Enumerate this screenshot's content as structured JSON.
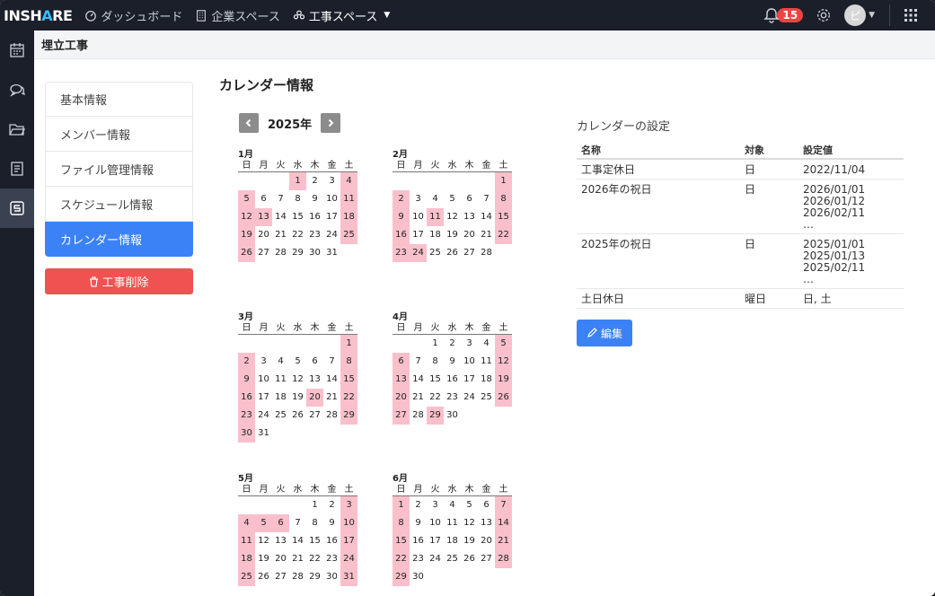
{
  "topbar": {
    "logo": "INSHARE",
    "nav": [
      {
        "label": "ダッシュボード",
        "icon": "dashboard-icon"
      },
      {
        "label": "企業スペース",
        "icon": "building-icon"
      },
      {
        "label": "工事スペース",
        "icon": "people-icon",
        "active": true
      }
    ],
    "notification_count": "15",
    "avatar_initial": "ピ"
  },
  "sidebar": {
    "items": [
      "calendar-icon",
      "chat-icon",
      "folder-icon",
      "document-icon",
      "schedule-icon"
    ],
    "active_index": 4
  },
  "page": {
    "breadcrumb": "埋立工事",
    "section_title": "カレンダー情報"
  },
  "leftnav": {
    "items": [
      "基本情報",
      "メンバー情報",
      "ファイル管理情報",
      "スケジュール情報",
      "カレンダー情報"
    ],
    "active_index": 4,
    "delete_label": "工事削除"
  },
  "calendar": {
    "year_label": "2025年",
    "weekdays": [
      "日",
      "月",
      "火",
      "水",
      "木",
      "金",
      "土"
    ],
    "holiday_color": "#f9c0cb",
    "months": [
      {
        "title": "1月",
        "offset": 3,
        "days": 31,
        "holidays": [
          1,
          4,
          5,
          11,
          12,
          13,
          18,
          19,
          25,
          26
        ]
      },
      {
        "title": "2月",
        "offset": 6,
        "days": 28,
        "holidays": [
          1,
          2,
          8,
          9,
          11,
          15,
          16,
          22,
          23,
          24
        ]
      },
      {
        "title": "3月",
        "offset": 6,
        "days": 31,
        "holidays": [
          1,
          2,
          8,
          9,
          15,
          16,
          20,
          22,
          23,
          29,
          30
        ]
      },
      {
        "title": "4月",
        "offset": 2,
        "days": 30,
        "holidays": [
          5,
          6,
          12,
          13,
          19,
          20,
          26,
          27,
          29
        ]
      },
      {
        "title": "5月",
        "offset": 4,
        "days": 31,
        "holidays": [
          3,
          4,
          5,
          6,
          10,
          11,
          17,
          18,
          24,
          25,
          31
        ]
      },
      {
        "title": "6月",
        "offset": 0,
        "days": 30,
        "holidays": [
          1,
          7,
          8,
          14,
          15,
          21,
          22,
          28,
          29
        ]
      }
    ]
  },
  "settings": {
    "title": "カレンダーの設定",
    "headers": [
      "名称",
      "対象",
      "設定値"
    ],
    "rows": [
      {
        "name": "工事定休日",
        "target": "日",
        "value": "2022/11/04"
      },
      {
        "name": "2026年の祝日",
        "target": "日",
        "value": "2026/01/01\n2026/01/12\n2026/02/11\n…"
      },
      {
        "name": "2025年の祝日",
        "target": "日",
        "value": "2025/01/01\n2025/01/13\n2025/02/11\n…"
      },
      {
        "name": "土日休日",
        "target": "曜日",
        "value": "日, 土"
      }
    ],
    "edit_label": "編集"
  }
}
